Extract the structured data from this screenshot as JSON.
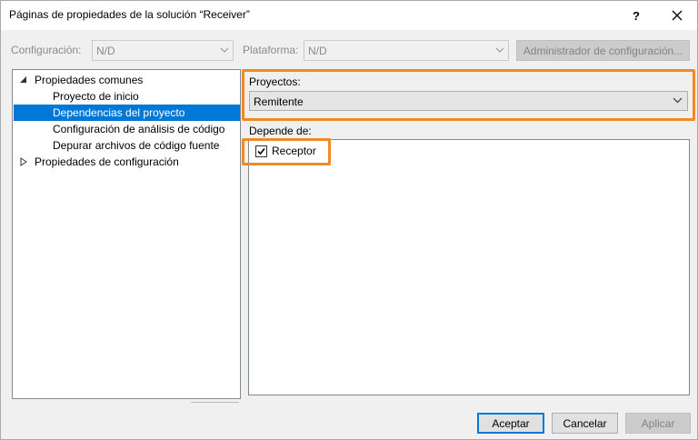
{
  "window": {
    "title": "Páginas de propiedades de la solución “Receiver”",
    "help_label": "?",
    "close_label": "✕"
  },
  "toolbar": {
    "config_label": "Configuración:",
    "config_value": "N/D",
    "platform_label": "Plataforma:",
    "platform_value": "N/D",
    "config_manager_label": "Administrador de configuración..."
  },
  "tree": {
    "items": [
      {
        "label": "Propiedades comunes",
        "expanded": true
      },
      {
        "label": "Proyecto de inicio"
      },
      {
        "label": "Dependencias del proyecto",
        "selected": true
      },
      {
        "label": "Configuración de análisis de código"
      },
      {
        "label": "Depurar archivos de código fuente"
      },
      {
        "label": "Propiedades de configuración",
        "expanded": false
      }
    ]
  },
  "main": {
    "projects_label": "Proyectos:",
    "projects_value": "Remitente",
    "depends_label": "Depende de:",
    "dependencies": [
      {
        "label": "Receptor",
        "checked": true
      }
    ]
  },
  "footer": {
    "accept_label": "Aceptar",
    "cancel_label": "Cancelar",
    "apply_label": "Aplicar"
  },
  "colors": {
    "highlight": "#f08a23",
    "selection": "#0078d7"
  }
}
